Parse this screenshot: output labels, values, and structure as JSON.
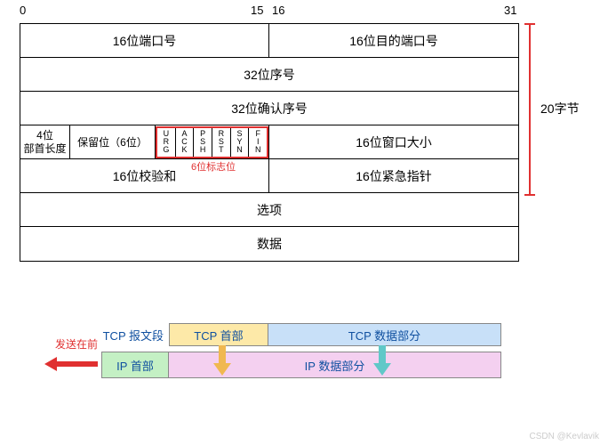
{
  "ruler": {
    "b0": "0",
    "b15": "15",
    "b16": "16",
    "b31": "31"
  },
  "header": {
    "src_port": "16位端口号",
    "dst_port": "16位目的端口号",
    "seq": "32位序号",
    "ack": "32位确认序号",
    "hlen_l1": "4位",
    "hlen_l2": "部首长度",
    "reserved": "保留位（6位）",
    "flags": [
      "URG",
      "ACK",
      "PSH",
      "RST",
      "SYN",
      "FIN"
    ],
    "flags_label": "6位标志位",
    "window": "16位窗口大小",
    "checksum": "16位校验和",
    "urgent": "16位紧急指针",
    "options": "选项",
    "data": "数据"
  },
  "size_label": "20字节",
  "lower": {
    "seg_label": "TCP 报文段",
    "tcp_head": "TCP 首部",
    "tcp_data": "TCP 数据部分",
    "send_first": "发送在前",
    "ip_head": "IP 首部",
    "ip_data": "IP 数据部分"
  },
  "watermark": "CSDN @Kevlavik",
  "chart_data": {
    "type": "table",
    "title": "TCP Header Format",
    "bit_width": 32,
    "rows": [
      [
        {
          "field": "16位端口号 (Source Port)",
          "bits": 16
        },
        {
          "field": "16位目的端口号 (Destination Port)",
          "bits": 16
        }
      ],
      [
        {
          "field": "32位序号 (Sequence Number)",
          "bits": 32
        }
      ],
      [
        {
          "field": "32位确认序号 (Acknowledgment Number)",
          "bits": 32
        }
      ],
      [
        {
          "field": "4位部首长度 (Header Length)",
          "bits": 4
        },
        {
          "field": "保留位 6位 (Reserved)",
          "bits": 6
        },
        {
          "field": "URG",
          "bits": 1
        },
        {
          "field": "ACK",
          "bits": 1
        },
        {
          "field": "PSH",
          "bits": 1
        },
        {
          "field": "RST",
          "bits": 1
        },
        {
          "field": "SYN",
          "bits": 1
        },
        {
          "field": "FIN",
          "bits": 1
        },
        {
          "field": "16位窗口大小 (Window Size)",
          "bits": 16
        }
      ],
      [
        {
          "field": "16位校验和 (Checksum)",
          "bits": 16
        },
        {
          "field": "16位紧急指针 (Urgent Pointer)",
          "bits": 16
        }
      ],
      [
        {
          "field": "选项 (Options)",
          "bits": 32
        }
      ],
      [
        {
          "field": "数据 (Data)",
          "bits": 32
        }
      ]
    ],
    "fixed_header_bytes": 20,
    "encapsulation": {
      "tcp_segment": [
        "TCP 首部",
        "TCP 数据部分"
      ],
      "ip_datagram": [
        "IP 首部",
        "IP 数据部分"
      ],
      "note": "发送在前 (sent first, leftmost)"
    }
  }
}
